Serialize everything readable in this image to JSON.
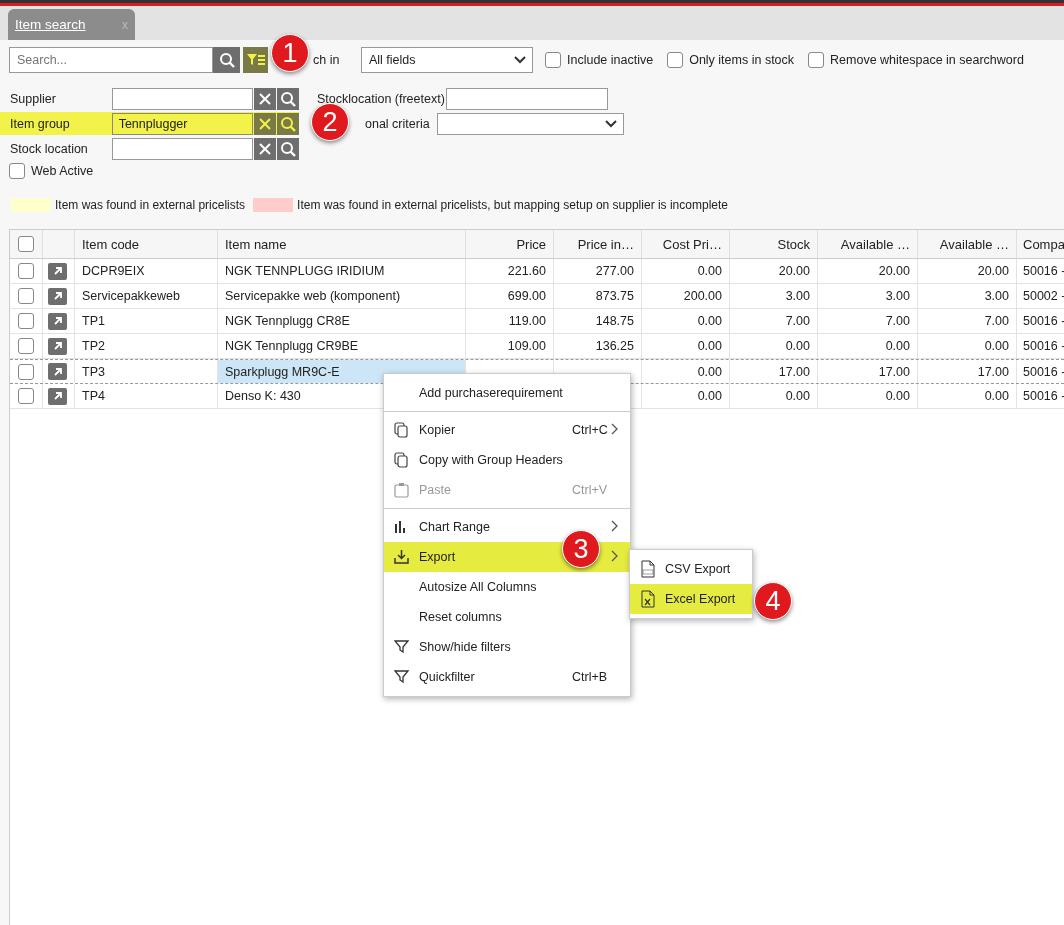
{
  "tab": {
    "label": "Item search",
    "close": "x",
    "selected": true
  },
  "search": {
    "placeholder": "Search...",
    "filter_active": true,
    "search_in_label": "ch in",
    "search_in_value": "All fields"
  },
  "options": [
    {
      "label": "Include inactive",
      "checked": false
    },
    {
      "label": "Only items in stock",
      "checked": false
    },
    {
      "label": "Remove whitespace in searchword",
      "checked": false
    }
  ],
  "fields": [
    {
      "label": "Supplier",
      "highlighted": false
    },
    {
      "label": "Item group",
      "value": "Tennplugger",
      "highlighted": true
    },
    {
      "label": "Stock location",
      "highlighted": false
    }
  ],
  "right_fields": [
    {
      "label": "Stocklocation (freetext)",
      "kind": "text"
    },
    {
      "label": "onal criteria",
      "kind": "select"
    }
  ],
  "web_active": {
    "label": "Web Active",
    "checked": false
  },
  "legend": [
    {
      "label": "Item was found in external pricelists",
      "color": "#ffffcc"
    },
    {
      "label": "Item was found in external pricelists, but mapping setup on supplier is incomplete",
      "color": "#ffcccc"
    }
  ],
  "table": {
    "header_checked": false,
    "columns": [
      "Item code",
      "Item name",
      "Price",
      "Price in…",
      "Cost Pri…",
      "Stock",
      "Available …",
      "Available …",
      "Compa"
    ],
    "rows": [
      {
        "checked": false,
        "focused": false,
        "cells": [
          "DCPR9EIX",
          "NGK TENNPLUGG IRIDIUM",
          "221.60",
          "277.00",
          "0.00",
          "20.00",
          "20.00",
          "20.00",
          "50016 -"
        ]
      },
      {
        "checked": false,
        "focused": false,
        "cells": [
          "Servicepakkeweb",
          "Servicepakke web (komponent)",
          "699.00",
          "873.75",
          "200.00",
          "3.00",
          "3.00",
          "3.00",
          "50002 -"
        ]
      },
      {
        "checked": false,
        "focused": false,
        "cells": [
          "TP1",
          "NGK Tennplugg CR8E",
          "119.00",
          "148.75",
          "0.00",
          "7.00",
          "7.00",
          "7.00",
          "50016 -"
        ]
      },
      {
        "checked": false,
        "focused": false,
        "cells": [
          "TP2",
          "NGK Tennplugg CR9BE",
          "109.00",
          "136.25",
          "0.00",
          "0.00",
          "0.00",
          "0.00",
          "50016 -"
        ]
      },
      {
        "checked": false,
        "focused": true,
        "cells": [
          "TP3",
          "Sparkplugg MR9C-E",
          "",
          "",
          "0.00",
          "17.00",
          "17.00",
          "17.00",
          "50016 -"
        ]
      },
      {
        "checked": false,
        "focused": false,
        "cells": [
          "TP4",
          "Denso K: 430",
          "",
          "",
          "0.00",
          "0.00",
          "0.00",
          "0.00",
          "50016 -"
        ]
      }
    ]
  },
  "context_menu": {
    "items": [
      {
        "kind": "plain",
        "label": "Add purchaserequirement",
        "disabled": false,
        "selected": false,
        "submenu": false
      },
      {
        "kind": "separator"
      },
      {
        "kind": "copy",
        "label": "Kopier",
        "shortcut": "Ctrl+C",
        "disabled": false,
        "selected": false,
        "submenu": true
      },
      {
        "kind": "copy",
        "label": "Copy with Group Headers",
        "disabled": false,
        "selected": false,
        "submenu": false
      },
      {
        "kind": "paste",
        "label": "Paste",
        "shortcut": "Ctrl+V",
        "disabled": true,
        "selected": false,
        "submenu": false
      },
      {
        "kind": "separator"
      },
      {
        "kind": "chart",
        "label": "Chart Range",
        "disabled": false,
        "selected": false,
        "submenu": true
      },
      {
        "kind": "download",
        "label": "Export",
        "disabled": false,
        "selected": true,
        "submenu": true
      },
      {
        "kind": "plain",
        "label": "Autosize All Columns",
        "disabled": false,
        "selected": false,
        "submenu": false
      },
      {
        "kind": "plain",
        "label": "Reset columns",
        "disabled": false,
        "selected": false,
        "submenu": false
      },
      {
        "kind": "filter",
        "label": "Show/hide filters",
        "disabled": false,
        "selected": false,
        "submenu": false
      },
      {
        "kind": "filter",
        "label": "Quickfilter",
        "shortcut": "Ctrl+B",
        "disabled": false,
        "selected": false,
        "submenu": false
      }
    ],
    "submenu": [
      {
        "kind": "csv",
        "label": "CSV Export",
        "selected": false
      },
      {
        "kind": "excel",
        "label": "Excel Export",
        "selected": true
      }
    ]
  },
  "callouts": [
    "1",
    "2",
    "3",
    "4"
  ]
}
